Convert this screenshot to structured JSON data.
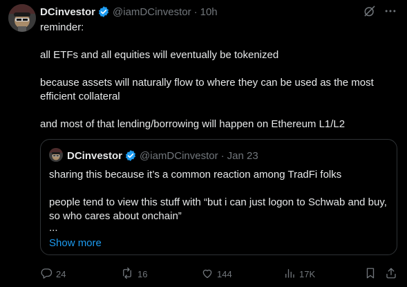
{
  "author": {
    "name": "DCinvestor",
    "handle": "@iamDCinvestor",
    "separator": "·",
    "time": "10h"
  },
  "tweet_text": [
    "reminder:",
    "all ETFs and all equities will eventually be tokenized",
    "because assets will naturally flow to where they can be used as the most efficient collateral",
    "and most of that lending/borrowing will happen on Ethereum L1/L2"
  ],
  "quoted": {
    "name": "DCinvestor",
    "handle": "@iamDCinvestor",
    "separator": "·",
    "time": "Jan 23",
    "text": [
      "sharing this because it’s a common reaction among TradFi folks",
      "people tend to view this stuff with “but i can just logon to Schwab and buy, so who cares about onchain”",
      "..."
    ],
    "show_more": "Show more"
  },
  "actions": {
    "replies": "24",
    "reposts": "16",
    "likes": "144",
    "views": "17K"
  },
  "icons": {
    "verified": "verified-badge-icon",
    "grok": "grok-icon",
    "more": "more-icon",
    "reply": "reply-icon",
    "repost": "repost-icon",
    "like": "like-icon",
    "views": "views-icon",
    "bookmark": "bookmark-icon",
    "share": "share-icon"
  },
  "colors": {
    "background": "#000000",
    "text": "#e7e9ea",
    "muted": "#71767b",
    "link": "#1d9bf0",
    "verified": "#1d9bf0",
    "border": "#2f3336"
  }
}
